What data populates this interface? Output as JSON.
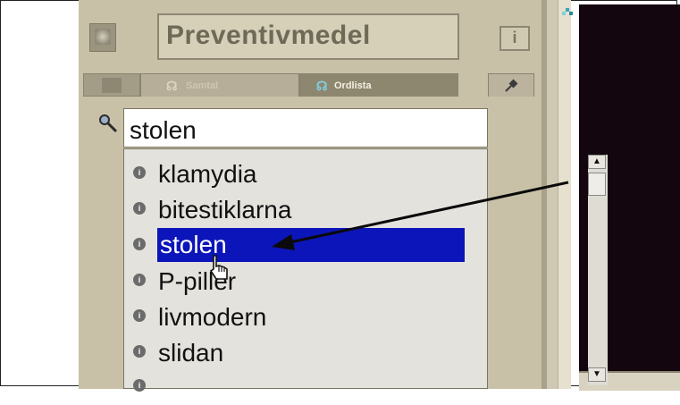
{
  "panel": {
    "title": "Preventivmedel",
    "info_button": "i",
    "tabs": [
      {
        "label": "Samtal",
        "active": false
      },
      {
        "label": "Ordlista",
        "active": true
      }
    ]
  },
  "search": {
    "value": "stolen"
  },
  "list": {
    "items": [
      {
        "bullet": "i",
        "label": "klamydia"
      },
      {
        "bullet": "i",
        "label": "bitestiklarna"
      },
      {
        "bullet": "i",
        "label": "stolen",
        "selected": true
      },
      {
        "bullet": "i",
        "label": "P-piller"
      },
      {
        "bullet": "i",
        "label": "livmodern"
      },
      {
        "bullet": "i",
        "label": "slidan"
      },
      {
        "bullet": "i",
        "label": ""
      }
    ],
    "scroll_up": "▲",
    "scroll_down": "▼"
  },
  "colors": {
    "panel": "#c8c1a8",
    "selection": "#0c15b9",
    "video": "#14060e"
  }
}
